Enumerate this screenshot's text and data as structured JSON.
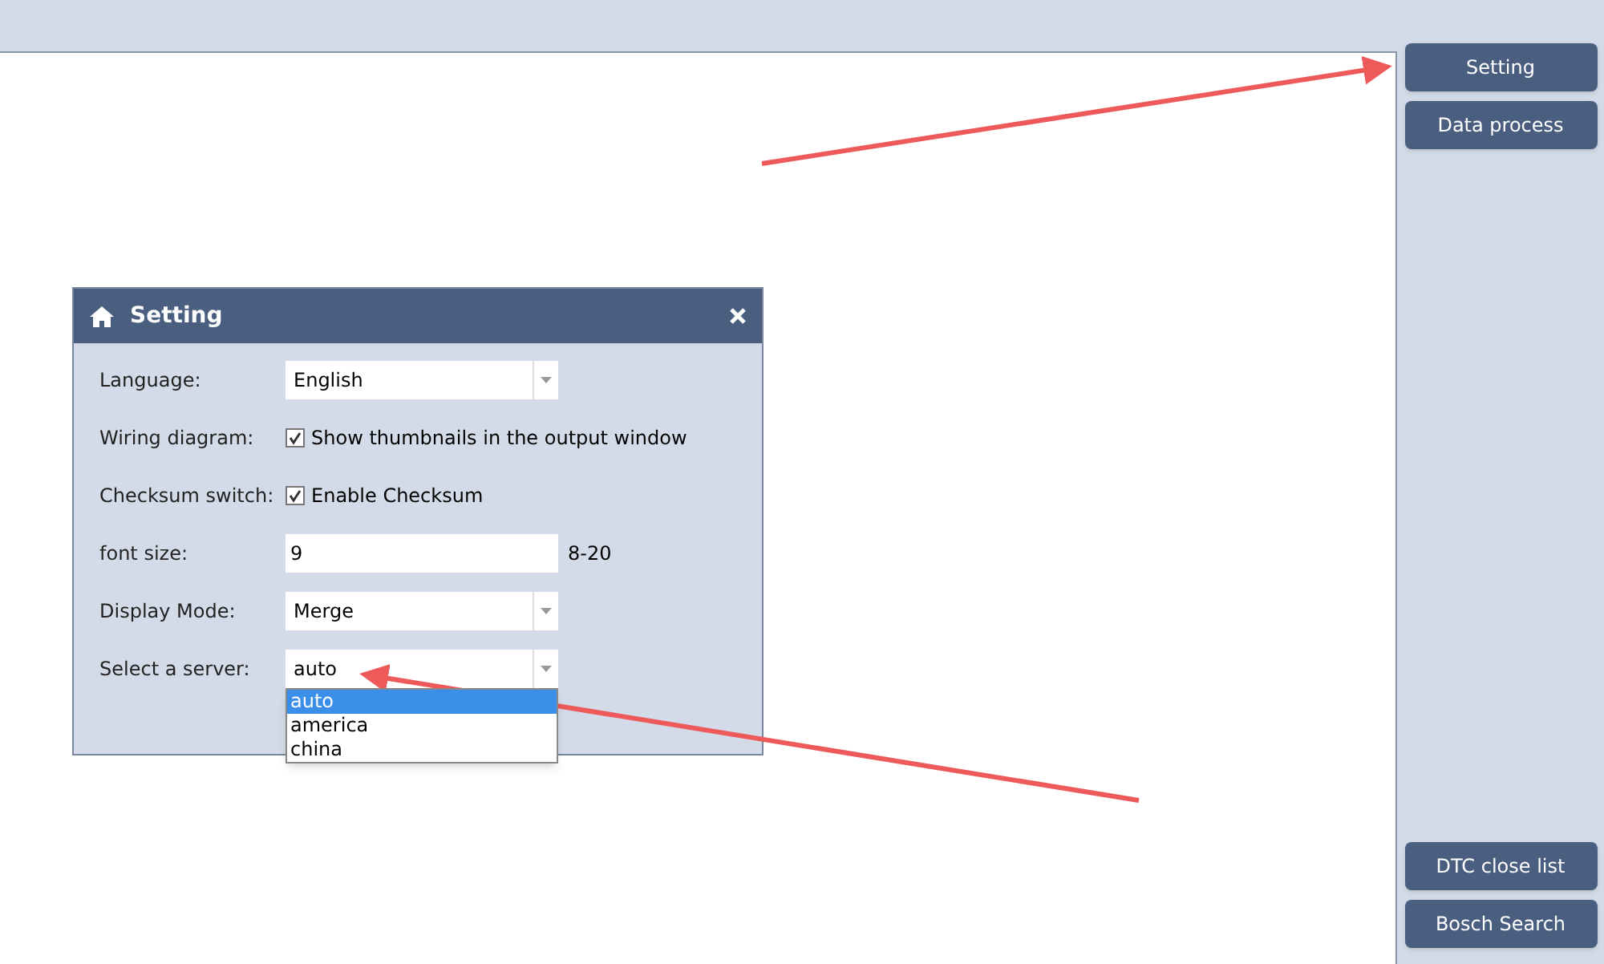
{
  "sidebar": {
    "top_buttons": [
      {
        "label": "Setting"
      },
      {
        "label": "Data process"
      }
    ],
    "bottom_buttons": [
      {
        "label": "DTC close list"
      },
      {
        "label": "Bosch Search"
      }
    ]
  },
  "dialog": {
    "title": "Setting",
    "rows": [
      {
        "kind": "select",
        "label": "Language:",
        "value": "English"
      },
      {
        "kind": "checkbox",
        "label": "Wiring diagram:",
        "text": "Show thumbnails in the output window",
        "checked": true
      },
      {
        "kind": "checkbox",
        "label": "Checksum switch:",
        "text": "Enable Checksum",
        "checked": true
      },
      {
        "kind": "input",
        "label": "font size:",
        "value": "9",
        "hint": "8-20"
      },
      {
        "kind": "select",
        "label": "Display Mode:",
        "value": "Merge"
      },
      {
        "kind": "select",
        "label": "Select a server:",
        "value": "auto",
        "options": [
          {
            "label": "auto",
            "selected": true
          },
          {
            "label": "america",
            "selected": false
          },
          {
            "label": "china",
            "selected": false
          }
        ]
      }
    ]
  }
}
